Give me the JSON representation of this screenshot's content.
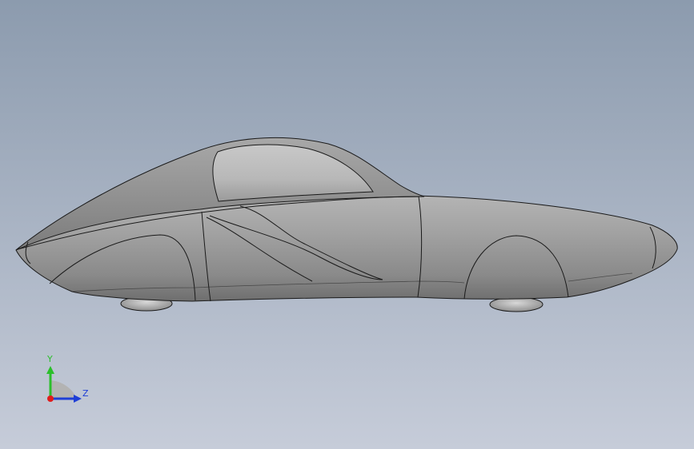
{
  "viewport": {
    "background_top": "#8c9bae",
    "background_bottom": "#c5cbd8",
    "model_color": "#8f8f8f",
    "edge_color": "#1a1a1a"
  },
  "triad": {
    "y_label": "Y",
    "z_label": "Z",
    "y_color": "#2bbf2b",
    "z_color": "#1f3fd6",
    "x_color": "#e01c1c"
  }
}
